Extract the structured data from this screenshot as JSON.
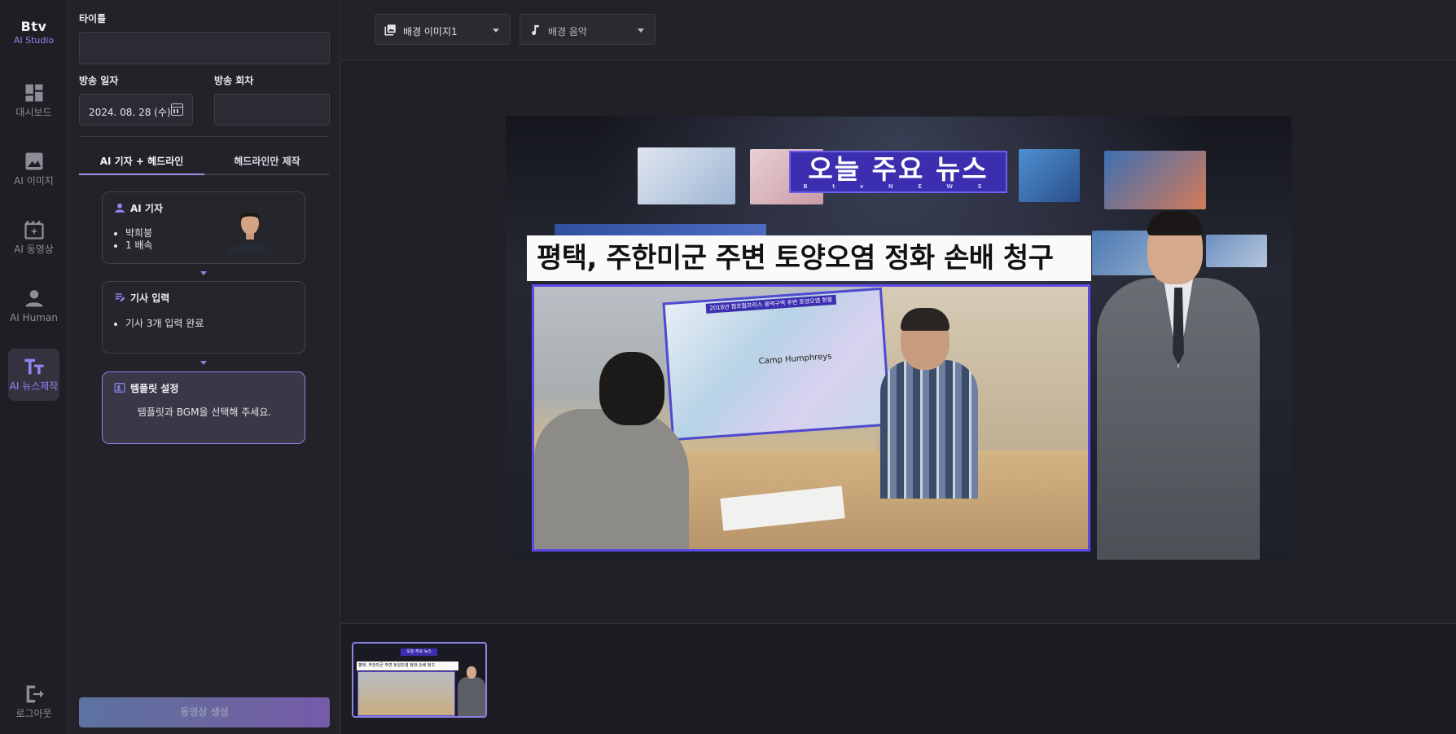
{
  "app": {
    "brand": "Btv",
    "product": "AI Studio"
  },
  "nav": [
    {
      "label": "대시보드",
      "icon": "dashboard-icon",
      "active": false
    },
    {
      "label": "AI 이미지",
      "icon": "image-icon",
      "active": false
    },
    {
      "label": "AI 동영상",
      "icon": "video-icon",
      "active": false
    },
    {
      "label": "AI Human",
      "icon": "person-icon",
      "active": false
    },
    {
      "label": "AI 뉴스제작",
      "icon": "text-size-icon",
      "active": true
    }
  ],
  "logout": {
    "label": "로그아웃",
    "icon": "logout-icon"
  },
  "form": {
    "title_label": "타이틀",
    "title_value": "",
    "date_label": "방송 일자",
    "date_value": "2024. 08. 28 (수)",
    "episode_label": "방송 회차",
    "episode_value": ""
  },
  "tabs": [
    {
      "label": "AI 기자 + 헤드라인",
      "active": true
    },
    {
      "label": "헤드라인만 제작",
      "active": false
    }
  ],
  "steps": {
    "reporter": {
      "title": "AI 기자",
      "items": [
        "박희붕",
        "1 배속"
      ]
    },
    "article": {
      "title": "기사 입력",
      "items": [
        "기사 3개 입력 완료"
      ]
    },
    "template": {
      "title": "템플릿 설정",
      "description": "템플릿과 BGM을 선택해 주세요."
    }
  },
  "generate_button": "동영상 생성",
  "toolbar": {
    "background_image": {
      "label": "배경 이미지1",
      "icon": "image-stack-icon"
    },
    "background_music": {
      "label": "배경 음악",
      "icon": "music-note-icon"
    }
  },
  "preview": {
    "title": "오늘 주요 뉴스",
    "subtitle": "B t v   N E W S",
    "headline": "평택, 주한미군 주변 토양오염 정화 손배 청구",
    "map_title": "2018년 캠프험프리스 용역구역 주변 토양오염 현황",
    "map_label": "Camp Humphreys"
  },
  "thumbnail": {
    "title": "오늘 주요 뉴스",
    "headline": "평택, 주한미군 주변 토양오염 정화 손배 청구"
  },
  "colors": {
    "accent": "#8b83e6",
    "accent_text": "#8f86f5",
    "title_banner": "#3b2fb0",
    "background": "#232229"
  }
}
